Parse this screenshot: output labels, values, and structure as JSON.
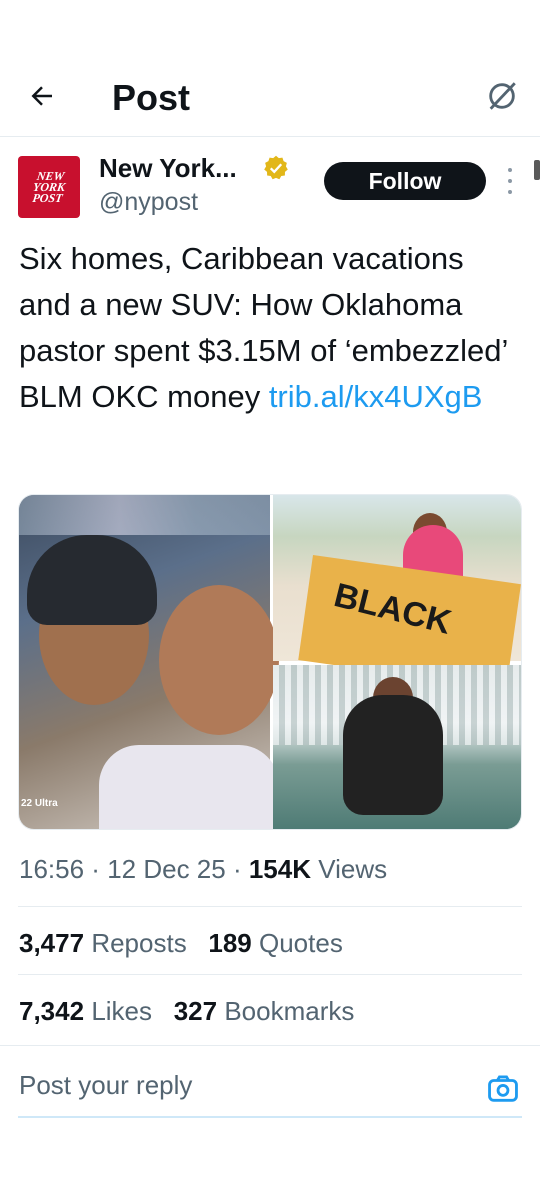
{
  "header": {
    "title": "Post"
  },
  "author": {
    "name": "New York...",
    "handle": "@nypost",
    "avatar_text_lines": [
      "NEW",
      "YORK",
      "POST"
    ],
    "follow_label": "Follow"
  },
  "post": {
    "text": "Six homes, Caribbean vacations and a new SUV: How Oklahoma pastor spent $3.15M of ‘embezzled’ BLM OKC money ",
    "link": "trib.al/kx4UXgB",
    "media": {
      "left_caption": "22 Ultra",
      "towel_text": "BLACK"
    }
  },
  "meta": {
    "time": "16:56",
    "date": "12 Dec 25",
    "views_count": "154K",
    "views_label": "Views"
  },
  "stats": {
    "reposts_count": "3,477",
    "reposts_label": "Reposts",
    "quotes_count": "189",
    "quotes_label": "Quotes",
    "likes_count": "7,342",
    "likes_label": "Likes",
    "bookmarks_count": "327",
    "bookmarks_label": "Bookmarks"
  },
  "reply": {
    "placeholder": "Post your reply"
  },
  "colors": {
    "accent": "#1d9bf0",
    "text": "#0f1419",
    "secondary": "#536471",
    "verified": "#e2b719",
    "brand_red": "#c8102e"
  },
  "icons": {
    "back": "arrow-left-icon",
    "grok": "grok-icon",
    "verified": "verified-badge-icon",
    "more": "more-vertical-icon",
    "camera": "camera-icon"
  }
}
